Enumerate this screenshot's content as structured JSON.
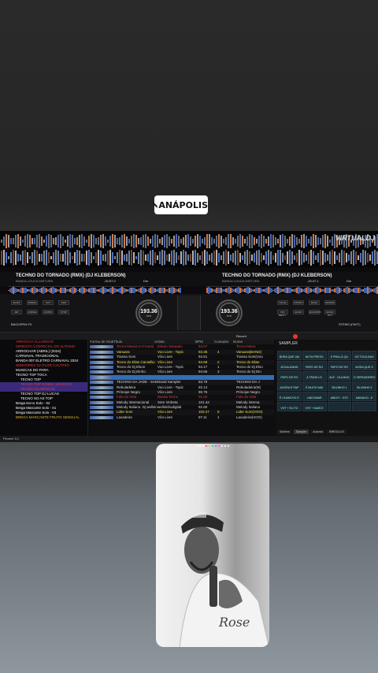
{
  "location_sticker": {
    "label": "ANÁPOLIS",
    "icon": "location-pin-icon"
  },
  "dj_app": {
    "brand_logo": "VIRTUALDJ",
    "deck_left": {
      "track": "TECHNO DO TORNADO (RMX) (DJ KLEBERSON)",
      "artist": "BANDA LOUCA MISTURA",
      "bpm": "193.36",
      "time": "-20:57.0",
      "key": "Dm"
    },
    "deck_right": {
      "track": "TECHNO DO TORNADO (RMX) (DJ KLEBERSON)",
      "artist": "BANDA LOUCA MISTURA",
      "bpm": "193.36",
      "time": "-20:47.1",
      "key": "Dm"
    },
    "left_pads": [
      "ECHO",
      "SPIRAL",
      "CUT",
      "SLIP",
      "JET",
      "CRUSH",
      "ROOM",
      "STOP"
    ],
    "left_pad_label": "BACKSPIN FX",
    "right_pads": [
      "VOCAL",
      "INSTRU",
      "BASS",
      "DRUMS",
      "ISO BEAT L",
      "ECHO",
      "ECHOFPO",
      "ECHO OUT"
    ],
    "right_pad_label": "STEMS (FAST)",
    "record_label": "Record",
    "folders": [
      {
        "name": "ARROCHA ALLAZINHO",
        "color": "#e23b3b"
      },
      {
        "name": "SERESTA // ESPECIAL DO ALTINHO",
        "color": "#e23b3b"
      },
      {
        "name": "ARROCHAR (ABRIL) (2024)",
        "color": "#ffffff"
      },
      {
        "name": "CARNAVAL TRADICIONAL",
        "color": "#ffffff"
      },
      {
        "name": "BANDA 007 ELETRO CARNAVAL 2024",
        "color": "#ffffff"
      },
      {
        "name": "SENHORES DA FLOR CALYPSO",
        "color": "#e23b3b"
      },
      {
        "name": "MUSICAS DO PARA",
        "color": "#ffffff"
      },
      {
        "name": "TECNO TOP TOCA",
        "color": "#ffffff"
      },
      {
        "name": "TECNO TOP",
        "color": "#ffffff"
      },
      {
        "name": "TECNO TOP ZANIEL SELECAO",
        "color": "#e23b3b"
      },
      {
        "name": "TECNO AS ANTIGAS",
        "color": "#e23b3b"
      },
      {
        "name": "TECNO TOP DJ LUCAS",
        "color": "#ffffff"
      },
      {
        "name": "TECNO SO AS TOP",
        "color": "#ffffff"
      },
      {
        "name": "Brega tecno Solo - 02",
        "color": "#ffffff"
      },
      {
        "name": "Brega Marcante Solo - 01",
        "color": "#ffffff"
      },
      {
        "name": "Brega Marcante Solo - 03",
        "color": "#ffffff"
      },
      {
        "name": "BREGA MARCANTE FRUTO SENSUAL",
        "color": "#e2b33b"
      }
    ],
    "columns": [
      "Forma de Onda",
      "Título",
      "Artista",
      "BPM",
      "Contador",
      "Nome"
    ],
    "tracks": [
      {
        "title": "Tecno Manos In Frontal",
        "artist": "Edson Sampaio",
        "bpm": "94.07",
        "count": "",
        "name": "Tecno Mano",
        "color": "#e23b3b"
      },
      {
        "title": "Vanuara",
        "artist": "Voo Livre - Topic",
        "bpm": "93.35",
        "count": "4",
        "name": "Vanuara(BAND)",
        "color": "#f1e04a"
      },
      {
        "title": "Transa Som",
        "artist": "Vôo Livre",
        "bpm": "94.51",
        "count": "",
        "name": "Transa Som(Voo)",
        "color": "#dddddd"
      },
      {
        "title": "Tecno do Elias Carvalho",
        "artist": "Vôo Livre",
        "bpm": "94.69",
        "count": "2",
        "name": "Tecno do Elias",
        "color": "#f1e04a"
      },
      {
        "title": "Tecno do Dj Elson",
        "artist": "Voo Livre - Topic",
        "bpm": "94.17",
        "count": "1",
        "name": "Tecno do Dj Elson",
        "color": "#dddddd"
      },
      {
        "title": "Tecno do Dj Dinho",
        "artist": "Vôo Livre",
        "bpm": "94.65",
        "count": "3",
        "name": "Tecno do Dj Din",
        "color": "#dddddd"
      },
      {
        "title": "",
        "artist": "",
        "bpm": "",
        "count": "",
        "name": "",
        "color": "#dddddd"
      },
      {
        "title": "TECHNO DA JADE - SAMP",
        "artist": "David Sampler",
        "bpm": "93.79",
        "count": "",
        "name": "TECHNO DA J",
        "color": "#dddddd"
      },
      {
        "title": "Rebuladeira",
        "artist": "Voo Livre - Topic",
        "bpm": "92.14",
        "count": "",
        "name": "Rebuladeira(M)",
        "color": "#dddddd"
      },
      {
        "title": "Príncipe Negro",
        "artist": "Vôo Livre",
        "bpm": "90.75",
        "count": "",
        "name": "Príncipe Negro",
        "color": "#dddddd"
      },
      {
        "title": "Fala da Vida",
        "artist": "Banda Tecno",
        "bpm": "92.02",
        "count": "",
        "name": "Fala da Vida",
        "color": "#e23b3b"
      },
      {
        "title": "Melody internacional",
        "artist": "Sem Vinheta",
        "bpm": "101.44",
        "count": "",
        "name": "Melody interna",
        "color": "#dddddd"
      },
      {
        "title": "Melody Italiano. Dj wellsin",
        "artist": "wellsinhodigital",
        "bpm": "92.80",
        "count": "",
        "name": "Melody Italiano",
        "color": "#dddddd"
      },
      {
        "title": "Lider Som",
        "artist": "Vôo Livre",
        "bpm": "103.27",
        "count": "5",
        "name": "Lider Som(VOO)",
        "color": "#f1e04a"
      },
      {
        "title": "Lavadeira",
        "artist": "Vôo Livre",
        "bpm": "87.11",
        "count": "1",
        "name": "Lavadeira(VOO)",
        "color": "#dddddd"
      }
    ],
    "sampler_title": "SAMPLER",
    "sampler_pads": [
      "BORA QUE VAI",
      "NOTA PRESS",
      "E PRA LÁ QU",
      "SÓ TOCA BAG",
      "ATUALIZAND",
      "PAPO DE RO",
      "PAPO DE RO",
      "AVISA QUE O",
      "PAPO DE RO",
      "A TRADI LG",
      "ALÉ - OLA BAG",
      "O VERDADEIRO",
      "AGORA É PAP",
      "É MUITO MAI",
      "SILVINHO 1",
      "SILVINHO 3",
      "É CHANCHO E",
      "LINDOMAR",
      "AWLEY - EST",
      "MANAGO - E",
      "VHT + EU TO",
      "VHT + MAIS E",
      "",
      ""
    ],
    "sampler_tabs": [
      "Sideline",
      "Sampler",
      "Automix",
      "BREGA LEI"
    ],
    "footer_text": "Pioneer DJ"
  }
}
